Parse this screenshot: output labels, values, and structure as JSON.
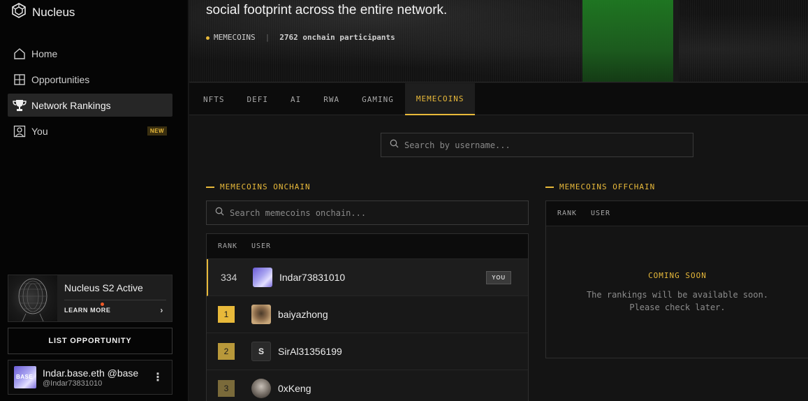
{
  "app": {
    "name": "Nucleus"
  },
  "sidebar": {
    "items": [
      {
        "label": "Home",
        "icon": "home-icon"
      },
      {
        "label": "Opportunities",
        "icon": "grid-icon"
      },
      {
        "label": "Network Rankings",
        "icon": "trophy-icon",
        "active": true
      },
      {
        "label": "You",
        "icon": "user-icon",
        "badge": "NEW"
      }
    ],
    "promo": {
      "title": "Nucleus S2 Active",
      "link": "LEARN MORE"
    },
    "list_opportunity": "LIST OPPORTUNITY",
    "user": {
      "name": "Indar.base.eth @base",
      "handle": "@Indar73831010"
    }
  },
  "hero": {
    "title": "social footprint across the entire network.",
    "category": "MEMECOINS",
    "separator": "|",
    "participants": "2762 onchain participants"
  },
  "tabs": [
    "NFTS",
    "DEFI",
    "AI",
    "RWA",
    "GAMING",
    "MEMECOINS"
  ],
  "active_tab": "MEMECOINS",
  "search": {
    "placeholder": "Search by username..."
  },
  "onchain": {
    "title": "MEMECOINS ONCHAIN",
    "search_placeholder": "Search memecoins onchain...",
    "headers": {
      "rank": "RANK",
      "user": "USER"
    },
    "you_row": {
      "rank": "334",
      "user": "Indar73831010",
      "badge": "YOU"
    },
    "rows": [
      {
        "rank": "1",
        "user": "baiyazhong",
        "color": "#e8b93a"
      },
      {
        "rank": "2",
        "user": "SirAl31356199",
        "color": "#b8983a",
        "avatar_letter": "S"
      },
      {
        "rank": "3",
        "user": "0xKeng",
        "color": "#7a6a3a"
      }
    ]
  },
  "offchain": {
    "title": "MEMECOINS OFFCHAIN",
    "headers": {
      "rank": "RANK",
      "user": "USER"
    },
    "status": "COMING SOON",
    "message_line1": "The rankings will be available soon.",
    "message_line2": "Please check later."
  }
}
